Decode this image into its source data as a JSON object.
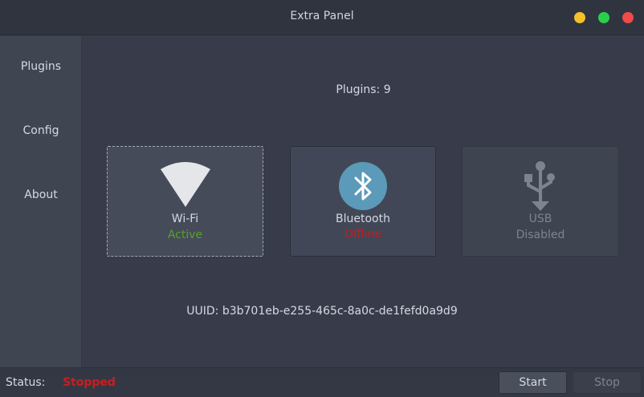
{
  "window": {
    "title": "Extra Panel"
  },
  "sidebar": {
    "items": [
      {
        "label": "Plugins"
      },
      {
        "label": "Config"
      },
      {
        "label": "About"
      }
    ]
  },
  "main": {
    "plugins_count": "Plugins: 9",
    "cards": [
      {
        "name": "Wi-Fi",
        "state": "Active",
        "state_color": "#5aa02c",
        "icon": "wifi-icon"
      },
      {
        "name": "Bluetooth",
        "state": "Offline",
        "state_color": "#cc1a1a",
        "icon": "bluetooth-icon"
      },
      {
        "name": "USB",
        "state": "Disabled",
        "state_color": "#7d838f",
        "icon": "usb-icon"
      }
    ],
    "uuid": "UUID: b3b701eb-e255-465c-8a0c-de1fefd0a9d9"
  },
  "statusbar": {
    "label": "Status:",
    "value": "Stopped",
    "value_color": "#c81e1e",
    "start_label": "Start",
    "stop_label": "Stop"
  }
}
